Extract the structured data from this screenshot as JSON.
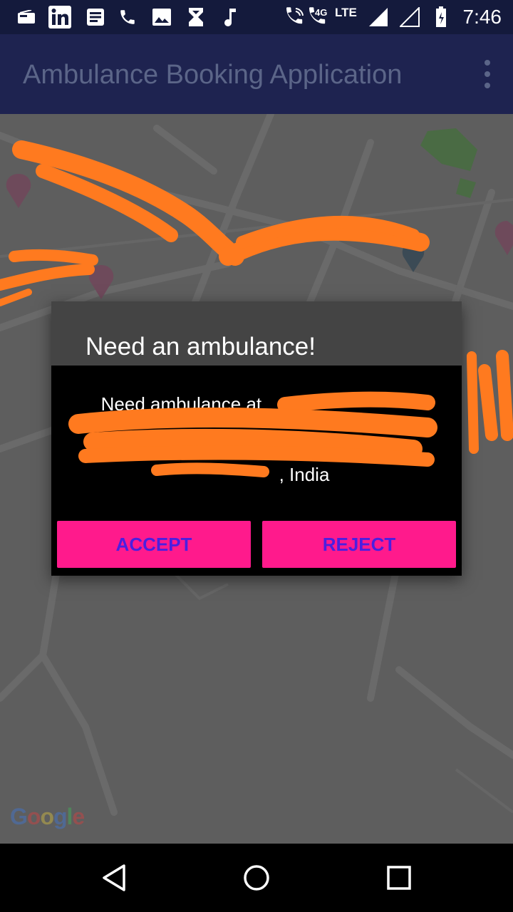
{
  "status_bar": {
    "network_4g": "4G",
    "network_lte": "LTE",
    "time": "7:46"
  },
  "app_bar": {
    "title": "Ambulance Booking Application",
    "overflow_icon": "more-vert-icon"
  },
  "dialog": {
    "title": "Need an ambulance!",
    "message_prefix": "Need ambulance at",
    "message_suffix": ", India",
    "accept_label": "ACCEPT",
    "reject_label": "REJECT"
  },
  "map": {
    "logo": "Google"
  },
  "colors": {
    "status_bar": "#141a3c",
    "app_bar": "#1e2350",
    "dialog_button": "#ff1a8c",
    "dialog_button_text": "#4b1fe0",
    "redaction": "#ff7a1f"
  },
  "icons": [
    "radio-icon",
    "linkedin-icon",
    "message-icon",
    "phone-icon",
    "image-icon",
    "hourglass-icon",
    "music-note-icon",
    "wifi-call-icon",
    "signal-icon",
    "battery-icon",
    "back-icon",
    "home-icon",
    "recents-icon"
  ]
}
